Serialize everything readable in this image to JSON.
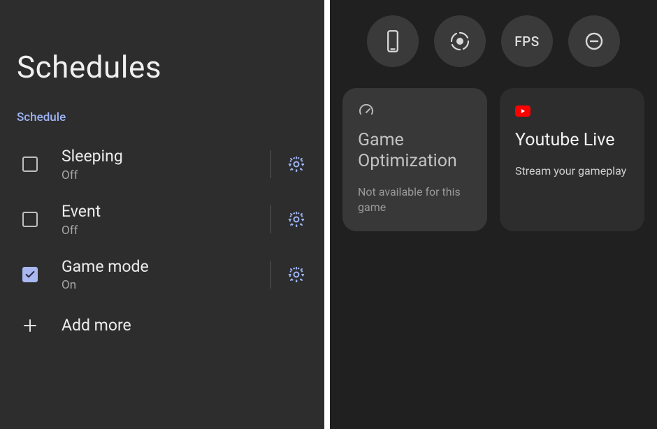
{
  "left": {
    "title": "Schedules",
    "section_label": "Schedule",
    "items": [
      {
        "name": "Sleeping",
        "status": "Off",
        "checked": false
      },
      {
        "name": "Event",
        "status": "Off",
        "checked": false
      },
      {
        "name": "Game mode",
        "status": "On",
        "checked": true
      }
    ],
    "add_label": "Add more"
  },
  "right": {
    "buttons": [
      {
        "id": "device",
        "label": "",
        "icon": "phone-screenshot"
      },
      {
        "id": "record",
        "label": "",
        "icon": "record-circle"
      },
      {
        "id": "fps",
        "label": "FPS",
        "icon": ""
      },
      {
        "id": "minimize",
        "label": "",
        "icon": "minimize-circle"
      }
    ],
    "cards": [
      {
        "id": "optimization",
        "icon": "speedometer",
        "title": "Game Optimization",
        "subtitle": "Not available for this game"
      },
      {
        "id": "youtube",
        "icon": "youtube",
        "title": "Youtube Live",
        "subtitle": "Stream your gameplay"
      }
    ]
  }
}
